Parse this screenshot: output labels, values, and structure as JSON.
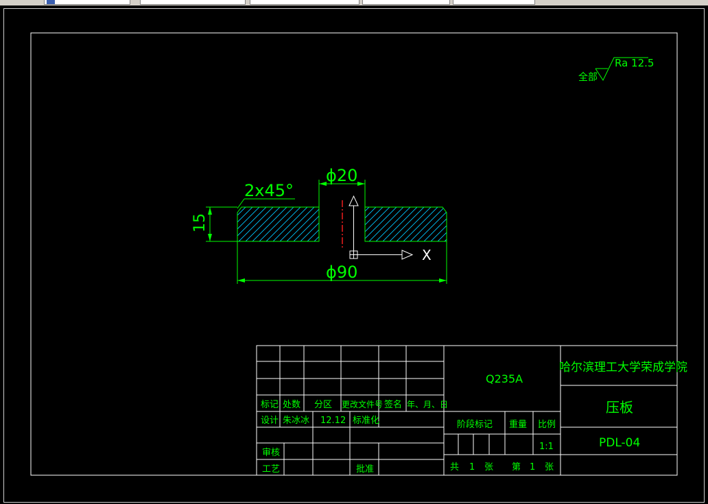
{
  "drawing": {
    "roughness": {
      "label": "全部",
      "value": "Ra 12.5"
    },
    "dimensions": {
      "chamfer": "2x45°",
      "hole_diameter": "ϕ20",
      "outer_diameter": "ϕ90",
      "thickness": "15"
    },
    "axis_label": "X"
  },
  "title_block": {
    "material": "Q235A",
    "institution": "哈尔滨理工大学荣成学院",
    "part_name": "压板",
    "drawing_no": "PDL-04",
    "headers": [
      "标记",
      "处数",
      "分区",
      "更改文件号",
      "签名",
      "年、月、日"
    ],
    "design_label": "设计",
    "designer": "朱冰冰",
    "design_date": "12.12",
    "standard_label": "标准化",
    "review_label": "审核",
    "process_label": "工艺",
    "approve_label": "批准",
    "stage_label": "阶段标记",
    "weight_label": "重量",
    "scale_label": "比例",
    "scale_value": "1:1",
    "sheets_total_label": "共",
    "sheets_total": "1",
    "sheet_unit": "张",
    "sheet_no_label": "第",
    "sheet_no": "1"
  },
  "colors": {
    "background": "#000000",
    "lines": "#00ff00",
    "border": "#ffffff",
    "hatch": "#00c8ff",
    "centerline": "#ff2020"
  }
}
